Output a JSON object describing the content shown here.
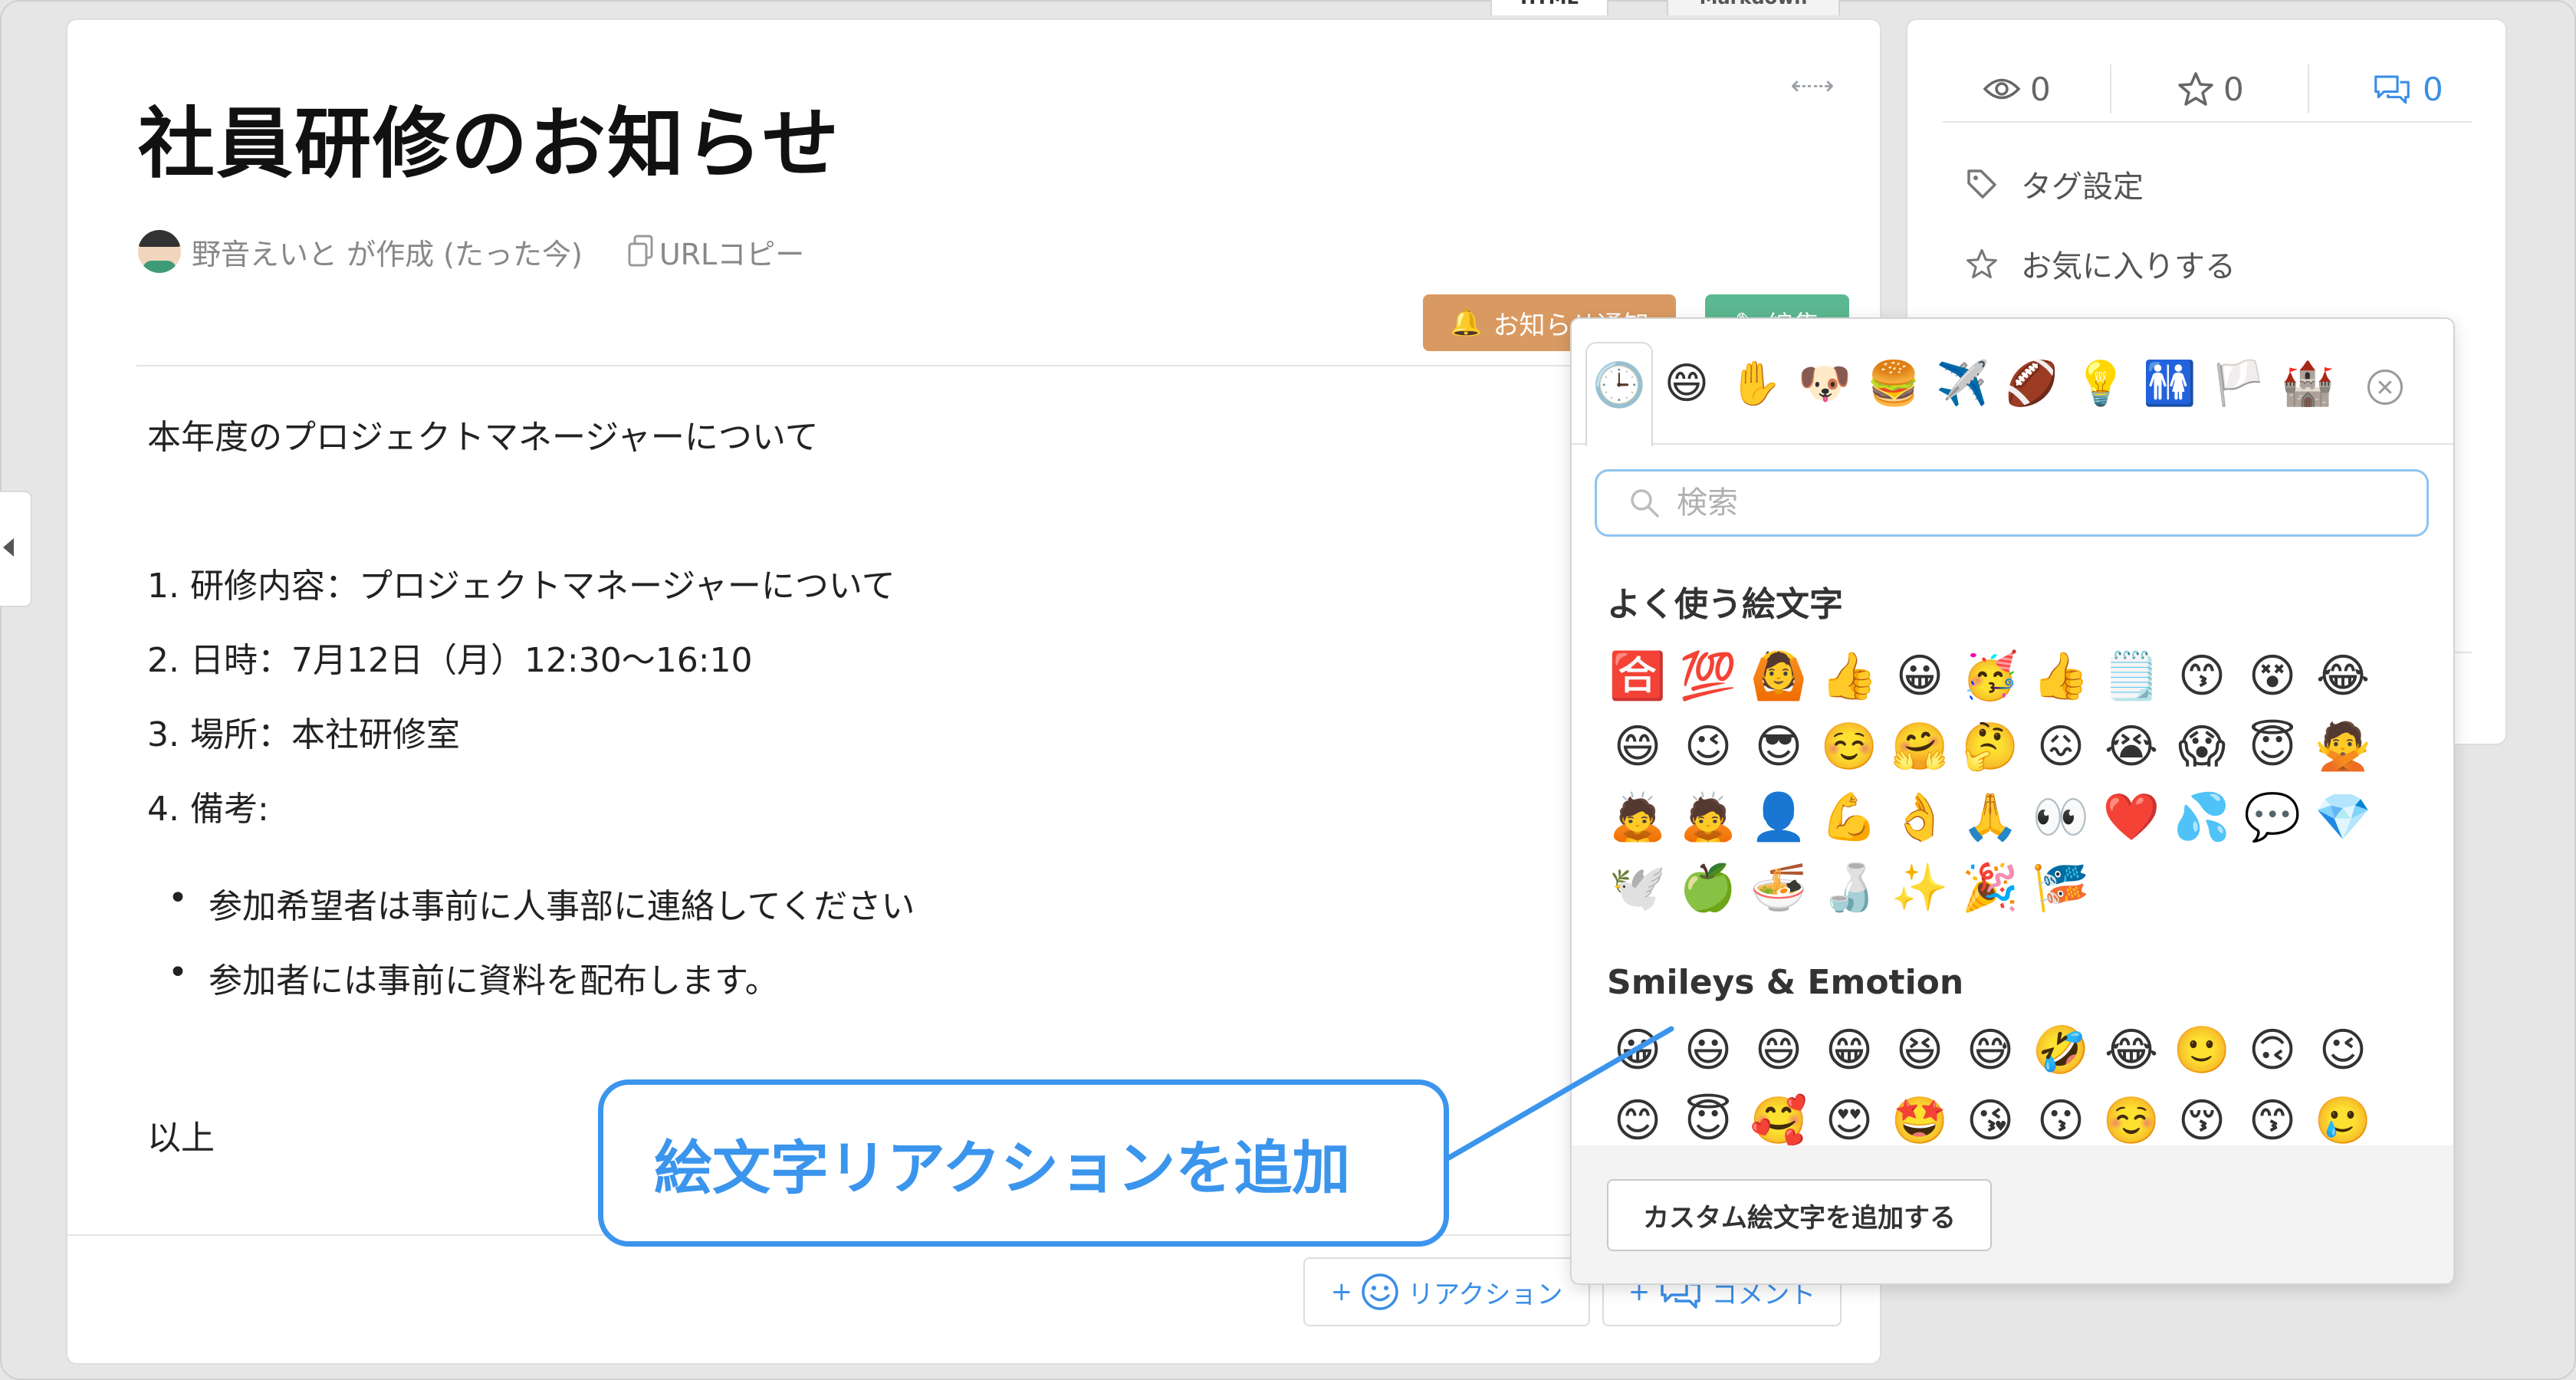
{
  "tabs": [
    {
      "label": "HTML",
      "active": true
    },
    {
      "label": "Markdown",
      "active": false
    }
  ],
  "article": {
    "title": "社員研修のお知らせ",
    "author": "野音えいと が作成 (たった今)",
    "copy_url_label": "URLコピー",
    "notify_button": "お知らせ通知",
    "edit_button": "編集",
    "intro": "本年度のプロジェクトマネージャーについて",
    "ordered": [
      "1. 研修内容：プロジェクトマネージャーについて",
      "2. 日時：7月12日（月）12:30〜16:10",
      "3. 場所：本社研修室",
      "4. 備考:"
    ],
    "bullets": [
      "参加希望者は事前に人事部に連絡してください",
      "参加者には事前に資料を配布します。"
    ],
    "outro": "以上",
    "reaction_button": "リアクション",
    "comment_button": "コメント"
  },
  "sidebar": {
    "views": "0",
    "stars": "0",
    "comments": "0",
    "tag_settings": "タグ設定",
    "favorite": "お気に入りする"
  },
  "picker": {
    "categories": [
      "🕒",
      "😄",
      "✋",
      "🐶",
      "🍔",
      "✈️",
      "🏈",
      "💡",
      "🚻",
      "🏳️",
      "🏰"
    ],
    "search_placeholder": "検索",
    "frequent_title": "よく使う絵文字",
    "frequent": [
      "🈴",
      "💯",
      "🙆",
      "👍",
      "😀",
      "🥳",
      "👍",
      "🗒️",
      "😙",
      "😵",
      "😂",
      "😄",
      "😉",
      "😎",
      "☺️",
      "🤗",
      "🤔",
      "😖",
      "😭",
      "😱",
      "😇",
      "🙅",
      "🙇",
      "🙇",
      "👤",
      "💪",
      "👌",
      "🙏",
      "👀",
      "❤️",
      "💦",
      "💬",
      "💎",
      "🕊️",
      "🍏",
      "🍜",
      "🍶",
      "✨",
      "🎉",
      "🎏"
    ],
    "smileys_title": "Smileys & Emotion",
    "smileys": [
      "😀",
      "😃",
      "😄",
      "😁",
      "😆",
      "😅",
      "🤣",
      "😂",
      "🙂",
      "🙃",
      "😉",
      "😊",
      "😇",
      "🥰",
      "😍",
      "🤩",
      "😘",
      "😗",
      "☺️",
      "😚",
      "😙",
      "🥲"
    ],
    "custom_button": "カスタム絵文字を追加する"
  },
  "callout": {
    "text": "絵文字リアクションを追加"
  },
  "colors": {
    "accent": "#3b95ec",
    "notify": "#d99a62",
    "edit": "#5cb891"
  }
}
